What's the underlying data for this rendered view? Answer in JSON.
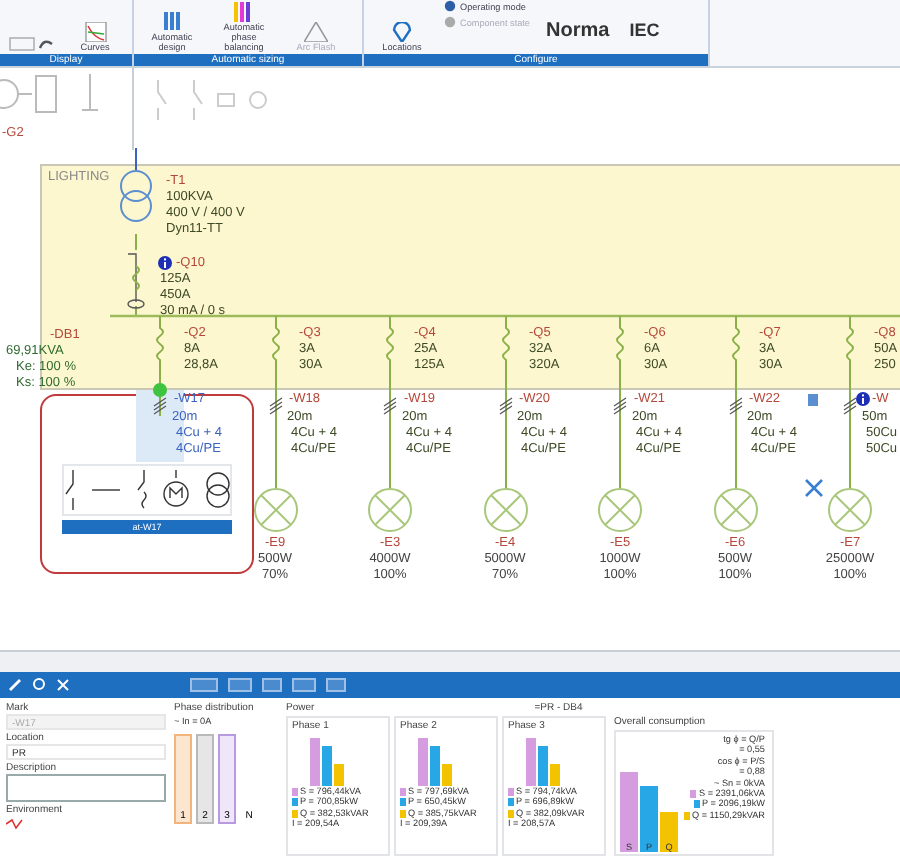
{
  "ribbon": {
    "groups": [
      {
        "label": "Display",
        "buttons": [
          {
            "label": "Curves",
            "kind": "large",
            "disabled": false
          }
        ]
      },
      {
        "label": "Automatic sizing",
        "buttons": [
          {
            "label": "Automatic design",
            "kind": "large",
            "disabled": false
          },
          {
            "label": "Automatic phase balancing",
            "kind": "large",
            "disabled": false
          },
          {
            "label": "Arc Flash",
            "kind": "large",
            "disabled": true
          }
        ]
      },
      {
        "label": "Configure",
        "buttons": [
          {
            "label": "Locations",
            "kind": "large",
            "disabled": false
          },
          {
            "label": "Operating mode",
            "kind": "small",
            "disabled": false
          },
          {
            "label": "Component state",
            "kind": "small",
            "disabled": true
          },
          {
            "label": "Norma",
            "kind": "text",
            "disabled": false
          },
          {
            "label": "IEC",
            "kind": "text",
            "disabled": false
          }
        ]
      }
    ]
  },
  "palette": {
    "generator_ref": "-G2"
  },
  "board": {
    "name": "LIGHTING"
  },
  "transformer": {
    "ref": "-T1",
    "lines": [
      "100KVA",
      "400 V / 400 V",
      "Dyn11-TT"
    ]
  },
  "main_breaker": {
    "ref": "-Q10",
    "info": true,
    "lines": [
      "125A",
      "450A",
      "30 mA / 0 s"
    ]
  },
  "distribution_board": {
    "ref": "-DB1",
    "lines": [
      "69,91KVA",
      "Ke: 100 %",
      "Ks: 100 %"
    ]
  },
  "feeders": [
    {
      "selected": true,
      "breaker": {
        "ref": "-Q2",
        "lines": [
          "8A",
          "28,8A"
        ]
      },
      "cable": {
        "ref": "-W17",
        "info": false,
        "lines": [
          "20m",
          "4Cu + 4",
          "4Cu/PE"
        ]
      }
    },
    {
      "selected": false,
      "breaker": {
        "ref": "-Q3",
        "lines": [
          "3A",
          "30A"
        ]
      },
      "cable": {
        "ref": "-W18",
        "info": false,
        "lines": [
          "20m",
          "4Cu + 4",
          "4Cu/PE"
        ]
      },
      "load": {
        "ref": "-E9",
        "lines": [
          "500W",
          "70%"
        ]
      }
    },
    {
      "selected": false,
      "breaker": {
        "ref": "-Q4",
        "lines": [
          "25A",
          "125A"
        ]
      },
      "cable": {
        "ref": "-W19",
        "info": false,
        "lines": [
          "20m",
          "4Cu + 4",
          "4Cu/PE"
        ]
      },
      "load": {
        "ref": "-E3",
        "lines": [
          "4000W",
          "100%"
        ]
      }
    },
    {
      "selected": false,
      "breaker": {
        "ref": "-Q5",
        "lines": [
          "32A",
          "320A"
        ]
      },
      "cable": {
        "ref": "-W20",
        "info": false,
        "lines": [
          "20m",
          "4Cu + 4",
          "4Cu/PE"
        ]
      },
      "load": {
        "ref": "-E4",
        "lines": [
          "5000W",
          "70%"
        ]
      }
    },
    {
      "selected": false,
      "breaker": {
        "ref": "-Q6",
        "lines": [
          "6A",
          "30A"
        ]
      },
      "cable": {
        "ref": "-W21",
        "info": false,
        "lines": [
          "20m",
          "4Cu + 4",
          "4Cu/PE"
        ]
      },
      "load": {
        "ref": "-E5",
        "lines": [
          "1000W",
          "100%"
        ]
      }
    },
    {
      "selected": false,
      "breaker": {
        "ref": "-Q7",
        "lines": [
          "3A",
          "30A"
        ]
      },
      "cable": {
        "ref": "-W22",
        "info": false,
        "lines": [
          "20m",
          "4Cu + 4",
          "4Cu/PE"
        ]
      },
      "load": {
        "ref": "-E6",
        "lines": [
          "500W",
          "100%"
        ]
      }
    },
    {
      "selected": false,
      "breaker": {
        "ref": "-Q8",
        "lines": [
          "50A",
          "250"
        ]
      },
      "cable": {
        "ref": "-W",
        "info": true,
        "lines": [
          "50m",
          "50Cu",
          "50Cu"
        ]
      },
      "load": {
        "ref": "-E7",
        "lines": [
          "25000W",
          "100%"
        ]
      }
    }
  ],
  "component_popup": {
    "label": "at-W17"
  },
  "properties": {
    "fields": [
      {
        "label": "Mark",
        "value": "-W17",
        "disabled": true
      },
      {
        "label": "Location",
        "value": "PR",
        "disabled": false
      },
      {
        "label": "Description",
        "disabled": false
      }
    ],
    "environment_label": "Environment"
  },
  "phase_distribution": {
    "title": "Phase distribution",
    "neutral": "~ In = 0A",
    "bars": [
      "1",
      "2",
      "3",
      "N"
    ]
  },
  "power": {
    "title": "Power",
    "board": "=PR - DB4",
    "phases": [
      {
        "title": "Phase 1",
        "lines": [
          "S = 796,44kVA",
          "P = 700,85kW",
          "Q = 382,53kVAR",
          "I = 209,54A"
        ]
      },
      {
        "title": "Phase 2",
        "lines": [
          "S = 797,69kVA",
          "P = 650,45kW",
          "Q = 385,75kVAR",
          "I = 209,39A"
        ]
      },
      {
        "title": "Phase 3",
        "lines": [
          "S = 794,74kVA",
          "P = 696,89kW",
          "Q = 382,09kVAR",
          "I = 208,57A"
        ]
      }
    ]
  },
  "overall": {
    "title": "Overall consumption",
    "ratios": [
      "tg ϕ = Q/P",
      "= 0,55",
      "cos ϕ = P/S",
      "= 0,88",
      "~ Sn = 0kVA"
    ],
    "lines": [
      "S = 2391,06kVA",
      "P = 2096,19kW",
      "Q = 1150,29kVAR"
    ],
    "bar_labels": [
      "S",
      "P",
      "Q"
    ]
  }
}
